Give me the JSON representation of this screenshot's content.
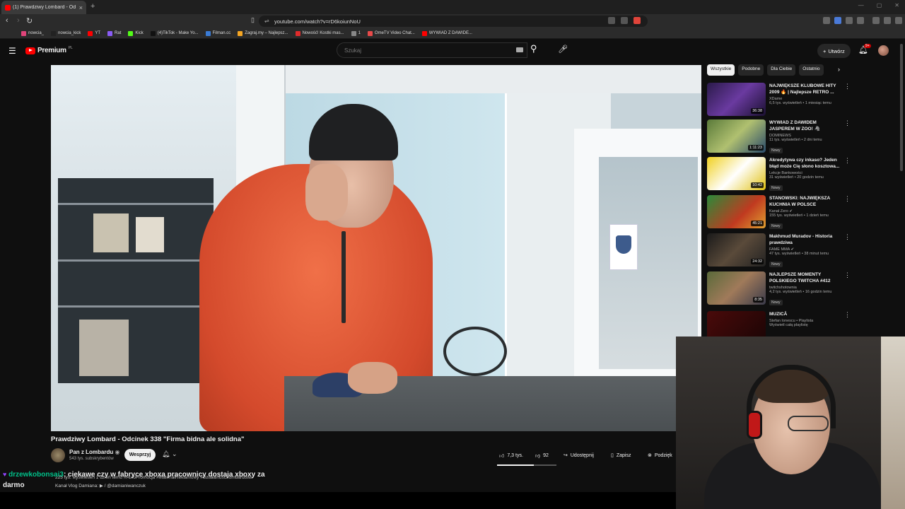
{
  "browser": {
    "tab_title": "(1) Prawdziwy Lombard - Od",
    "url": "youtube.com/watch?v=rD6koiunNoU",
    "bookmarks": [
      {
        "label": "nowcia_",
        "color": "#e0447a"
      },
      {
        "label": "nowcia_kick",
        "color": "#222222"
      },
      {
        "label": "YT",
        "color": "#ff0000"
      },
      {
        "label": "Rat",
        "color": "#8a5cf5"
      },
      {
        "label": "Kick",
        "color": "#53fc18"
      },
      {
        "label": "(4)TikTok - Make Yo...",
        "color": "#111111"
      },
      {
        "label": "Filman.cc",
        "color": "#3a7bd5"
      },
      {
        "label": "Zagraj.my – Najlepsz...",
        "color": "#f5a623"
      },
      {
        "label": "Nowość! Kostki mas...",
        "color": "#e02b2b"
      },
      {
        "label": "1",
        "color": "#888888"
      },
      {
        "label": "OmeTV Video Chat...",
        "color": "#e84a4a"
      },
      {
        "label": "WYWIAD Z DAWIDE...",
        "color": "#ff0000"
      }
    ]
  },
  "header": {
    "logo_text": "Premium",
    "region": "PL",
    "search_placeholder": "Szukaj",
    "create_label": "Utwórz",
    "notif_count": "9+"
  },
  "video": {
    "title": "Prawdziwy Lombard - Odcinek 338 \"Firma bidna ale solidna\"",
    "channel": "Pan z Lombardu",
    "subs": "543 tys. subskrybentów",
    "support_label": "Wesprzyj",
    "likes": "7,3 tys.",
    "dislikes": "92",
    "like_ratio": 0.62,
    "share_label": "Udostępnij",
    "save_label": "Zapisz",
    "thanks_label": "Podzięk",
    "desc_line1": "225 tys. wyświetleń  1 dzień temu  #AutoPromocja #MateriałReklamowy #DziałalnośćLombardowa",
    "desc_line2": "Kanał Vlog Damiana:  ▶ / @damianiwanczuk"
  },
  "chat": {
    "user": "drzewkobonsai3",
    "message": ": ciekawe czy w fabryce xboxa pracownicy dostaja xboxy za darmo"
  },
  "sidebar": {
    "chips": [
      "Wszystkie",
      "Podobne",
      "Dla Ciebie",
      "Ostatnio"
    ],
    "items": [
      {
        "title": "NAJWIĘKSZE KLUBOWE HITY 2009 🔥 | Najlepsze RETRO ...",
        "channel": "XDame",
        "meta": "6,5 tys. wyświetleń • 1 miesiąc temu",
        "duration": "36:38",
        "badge": "",
        "thumb": "linear-gradient(135deg,#2a1a4a,#6a3aa0 50%,#1a1030)"
      },
      {
        "title": "WYWIAD Z DAWIDEM JASPEREM W ZOO! 🦓",
        "channel": "DOMINEWS",
        "meta": "11 tys. wyświetleń • 2 dni temu",
        "duration": "1:11:23",
        "badge": "Nowy",
        "thumb": "linear-gradient(135deg,#5a7a3a,#b0c070 50%,#2a4a6a)"
      },
      {
        "title": "Akredytywa czy inkaso? Jeden błąd może Cię słono kosztowa...",
        "channel": "Lekcje Bankowości",
        "meta": "31 wyświetleń • 20 godzin temu",
        "duration": "10:42",
        "badge": "Nowy",
        "thumb": "linear-gradient(135deg,#f0d020,#ffffff 50%,#e0c010)"
      },
      {
        "title": "STANOWSKI: NAJWIĘKSZA KUCHNIA W POLSCE",
        "channel": "Kanał Zero ✔",
        "meta": "155 tys. wyświetleń • 1 dzień temu",
        "duration": "45:21",
        "badge": "Nowy",
        "thumb": "linear-gradient(135deg,#2a8a3a,#c03a20 60%,#e0a030)"
      },
      {
        "title": "Makhmud Muradov - Historia prawdziwa",
        "channel": "FAME MMA ✔",
        "meta": "47 tys. wyświetleń • 38 minut temu",
        "duration": "24:32",
        "badge": "Nowy",
        "thumb": "linear-gradient(135deg,#1a1a1a,#5a4a3a 50%,#222)"
      },
      {
        "title": "NAJLEPSZE MOMENTY POLSKIEGO TWITCHA #412",
        "channel": "twitchshotownia",
        "meta": "4,2 tys. wyświetleń • 16 godzin temu",
        "duration": "8:35",
        "badge": "Nowy",
        "thumb": "linear-gradient(135deg,#5a6a3a,#a07a5a 50%,#3a3a4a)"
      },
      {
        "title": "MUZICĂ",
        "channel": "Stefan Ionescu • Playlista",
        "meta": "Wyświetl całą playlistę",
        "duration": "",
        "badge": "",
        "thumb": "linear-gradient(135deg,#4a0a0a,#1a0505)"
      }
    ]
  }
}
